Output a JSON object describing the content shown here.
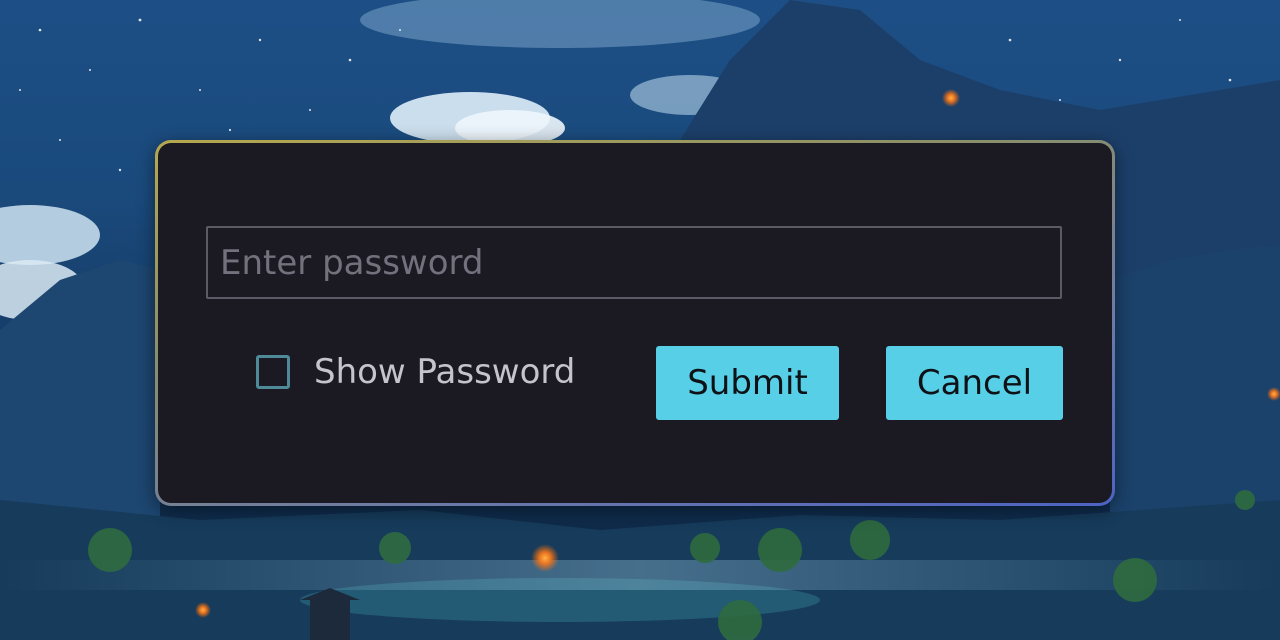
{
  "dialog": {
    "password_field": {
      "value": "",
      "placeholder": "Enter password"
    },
    "show_password": {
      "label": "Show Password",
      "checked": false
    },
    "buttons": {
      "submit_label": "Submit",
      "cancel_label": "Cancel"
    }
  },
  "colors": {
    "dialog_background": "#1b1a23",
    "dialog_border_top": "#b6a84e",
    "dialog_border_bottom": "#4d63c3",
    "button_accent": "#57cfe6",
    "checkbox_border": "#4f8a98"
  }
}
